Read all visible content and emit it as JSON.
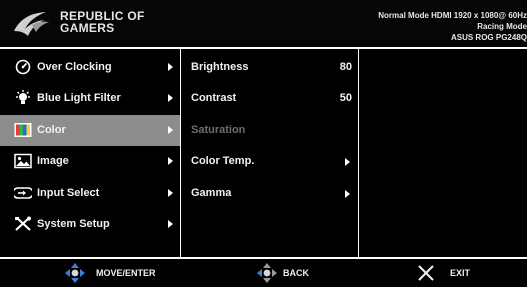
{
  "header": {
    "brand_line1": "REPUBLIC OF",
    "brand_line2": "GAMERS",
    "status_line1": "Normal Mode HDMI 1920 x 1080@ 60Hz",
    "status_line2": "Racing Mode",
    "status_line3": "ASUS ROG PG248Q"
  },
  "main_menu": [
    {
      "label": "Over Clocking",
      "icon": "speedometer-icon",
      "selected": false
    },
    {
      "label": "Blue Light Filter",
      "icon": "lightbulb-icon",
      "selected": false
    },
    {
      "label": "Color",
      "icon": "color-palette-icon",
      "selected": true
    },
    {
      "label": "Image",
      "icon": "image-icon",
      "selected": false
    },
    {
      "label": "Input Select",
      "icon": "input-icon",
      "selected": false
    },
    {
      "label": "System Setup",
      "icon": "tools-icon",
      "selected": false
    }
  ],
  "submenu": [
    {
      "label": "Brightness",
      "value": "80",
      "enabled": true
    },
    {
      "label": "Contrast",
      "value": "50",
      "enabled": true
    },
    {
      "label": "Saturation",
      "value": "",
      "enabled": false
    },
    {
      "label": "Color Temp.",
      "value": "",
      "enabled": true
    },
    {
      "label": "Gamma",
      "value": "",
      "enabled": true
    }
  ],
  "footer": {
    "move_enter": "MOVE/ENTER",
    "back": "BACK",
    "exit": "EXIT"
  },
  "colors": {
    "background": "#000000",
    "selected_row": "#8d8d8d",
    "text": "#f1f1f1",
    "disabled_text": "#6d6d6d",
    "joystick_blue": "#3a7fe0"
  }
}
